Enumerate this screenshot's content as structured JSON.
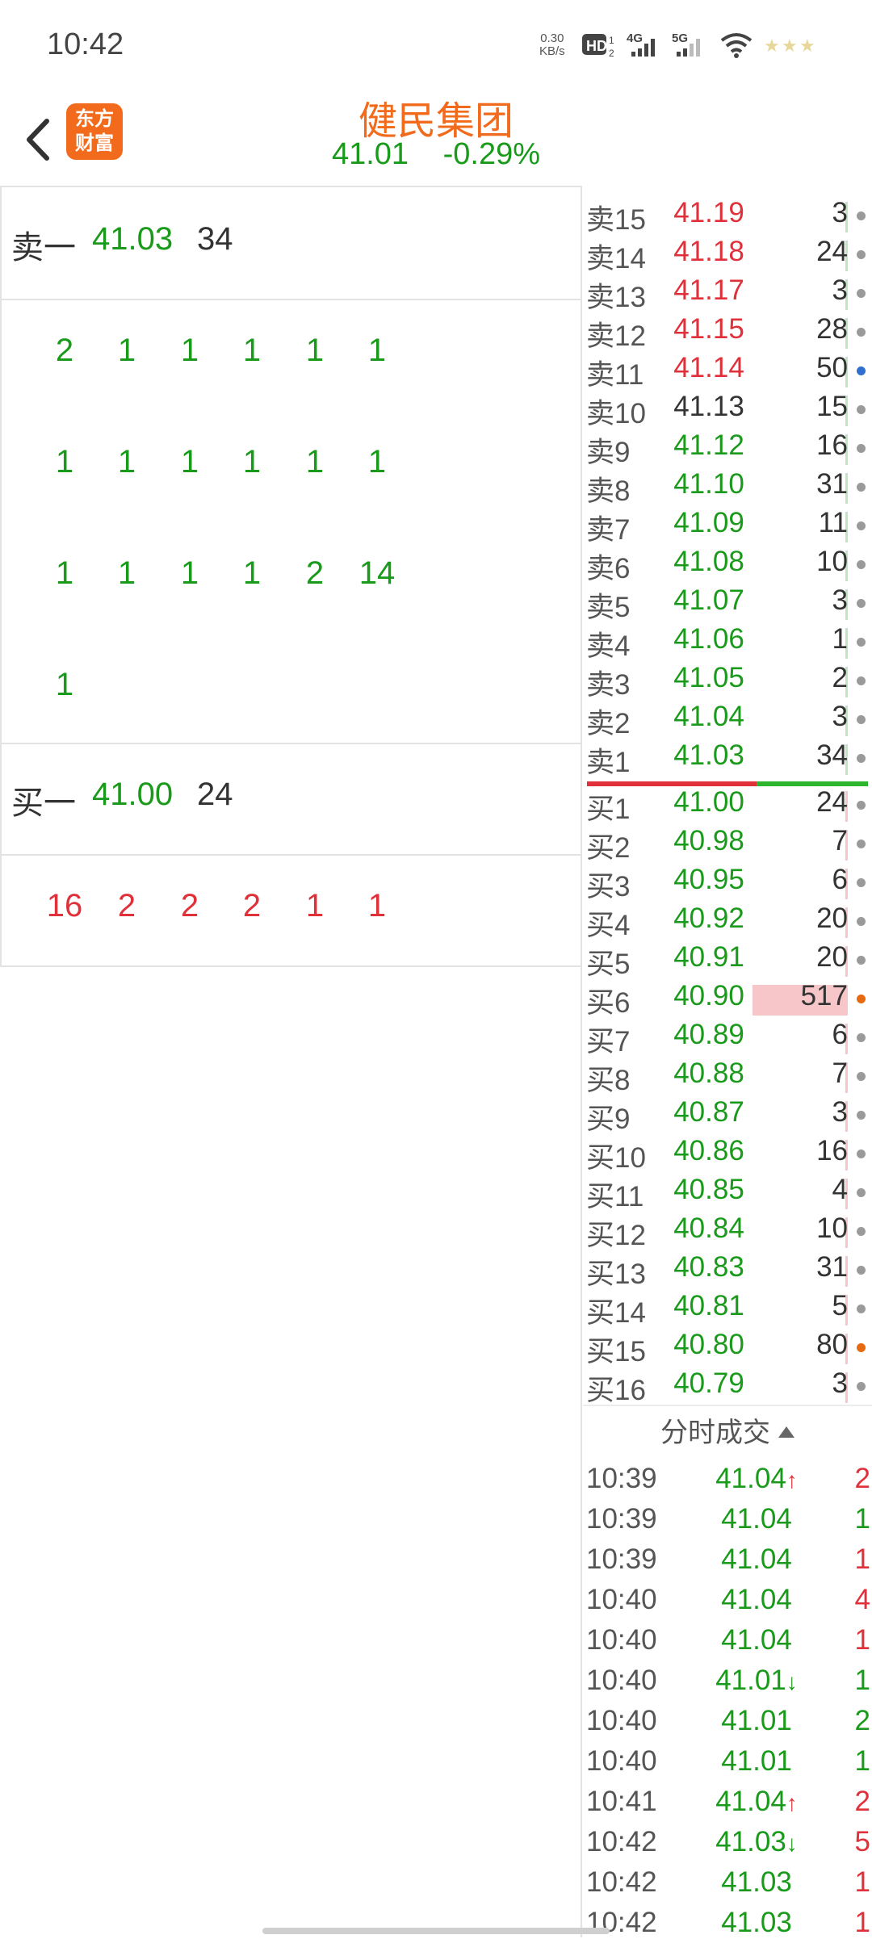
{
  "status_bar": {
    "time": "10:42",
    "speed_value": "0.30",
    "speed_unit": "KB/s",
    "icons": [
      "hd-icon",
      "signal-4g-icon",
      "signal-5g-icon",
      "wifi-icon",
      "battery-icon"
    ]
  },
  "header": {
    "title": "健民集团",
    "price": "41.01",
    "change": "-0.29%",
    "logo_line1": "东方",
    "logo_line2": "财富",
    "brand_color": "#f26a1b"
  },
  "left": {
    "sell": {
      "label": "卖一",
      "price": "41.03",
      "volume": "34"
    },
    "sell_queue": [
      [
        "2",
        "1",
        "1",
        "1",
        "1",
        "1"
      ],
      [
        "1",
        "1",
        "1",
        "1",
        "1",
        "1"
      ],
      [
        "1",
        "1",
        "1",
        "1",
        "2",
        "14"
      ],
      [
        "1"
      ]
    ],
    "buy": {
      "label": "买一",
      "price": "41.00",
      "volume": "24"
    },
    "buy_queue": [
      [
        "16",
        "2",
        "2",
        "2",
        "1",
        "1"
      ]
    ]
  },
  "order_book": {
    "asks": [
      {
        "label": "卖15",
        "price": "41.19",
        "vol": "3",
        "color": "red",
        "dot": "gray",
        "bar": 0
      },
      {
        "label": "卖14",
        "price": "41.18",
        "vol": "24",
        "color": "red",
        "dot": "gray",
        "bar": 0
      },
      {
        "label": "卖13",
        "price": "41.17",
        "vol": "3",
        "color": "red",
        "dot": "gray",
        "bar": 0
      },
      {
        "label": "卖12",
        "price": "41.15",
        "vol": "28",
        "color": "red",
        "dot": "gray",
        "bar": 0
      },
      {
        "label": "卖11",
        "price": "41.14",
        "vol": "50",
        "color": "red",
        "dot": "blue",
        "bar": 0
      },
      {
        "label": "卖10",
        "price": "41.13",
        "vol": "15",
        "color": "dark",
        "dot": "gray",
        "bar": 0
      },
      {
        "label": "卖9",
        "price": "41.12",
        "vol": "16",
        "color": "green",
        "dot": "gray",
        "bar": 0
      },
      {
        "label": "卖8",
        "price": "41.10",
        "vol": "31",
        "color": "green",
        "dot": "gray",
        "bar": 0
      },
      {
        "label": "卖7",
        "price": "41.09",
        "vol": "11",
        "color": "green",
        "dot": "gray",
        "bar": 0
      },
      {
        "label": "卖6",
        "price": "41.08",
        "vol": "10",
        "color": "green",
        "dot": "gray",
        "bar": 0
      },
      {
        "label": "卖5",
        "price": "41.07",
        "vol": "3",
        "color": "green",
        "dot": "gray",
        "bar": 0
      },
      {
        "label": "卖4",
        "price": "41.06",
        "vol": "1",
        "color": "green",
        "dot": "gray",
        "bar": 0
      },
      {
        "label": "卖3",
        "price": "41.05",
        "vol": "2",
        "color": "green",
        "dot": "gray",
        "bar": 0
      },
      {
        "label": "卖2",
        "price": "41.04",
        "vol": "3",
        "color": "green",
        "dot": "gray",
        "bar": 0
      },
      {
        "label": "卖1",
        "price": "41.03",
        "vol": "34",
        "color": "green",
        "dot": "gray",
        "bar": 0
      }
    ],
    "bids": [
      {
        "label": "买1",
        "price": "41.00",
        "vol": "24",
        "color": "green",
        "dot": "gray",
        "bar": 0
      },
      {
        "label": "买2",
        "price": "40.98",
        "vol": "7",
        "color": "green",
        "dot": "gray",
        "bar": 0
      },
      {
        "label": "买3",
        "price": "40.95",
        "vol": "6",
        "color": "green",
        "dot": "gray",
        "bar": 0
      },
      {
        "label": "买4",
        "price": "40.92",
        "vol": "20",
        "color": "green",
        "dot": "gray",
        "bar": 0
      },
      {
        "label": "买5",
        "price": "40.91",
        "vol": "20",
        "color": "green",
        "dot": "gray",
        "bar": 0
      },
      {
        "label": "买6",
        "price": "40.90",
        "vol": "517",
        "color": "green",
        "dot": "orange",
        "bar": 1
      },
      {
        "label": "买7",
        "price": "40.89",
        "vol": "6",
        "color": "green",
        "dot": "gray",
        "bar": 0
      },
      {
        "label": "买8",
        "price": "40.88",
        "vol": "7",
        "color": "green",
        "dot": "gray",
        "bar": 0
      },
      {
        "label": "买9",
        "price": "40.87",
        "vol": "3",
        "color": "green",
        "dot": "gray",
        "bar": 0
      },
      {
        "label": "买10",
        "price": "40.86",
        "vol": "16",
        "color": "green",
        "dot": "gray",
        "bar": 0
      },
      {
        "label": "买11",
        "price": "40.85",
        "vol": "4",
        "color": "green",
        "dot": "gray",
        "bar": 0
      },
      {
        "label": "买12",
        "price": "40.84",
        "vol": "10",
        "color": "green",
        "dot": "gray",
        "bar": 0
      },
      {
        "label": "买13",
        "price": "40.83",
        "vol": "31",
        "color": "green",
        "dot": "gray",
        "bar": 0
      },
      {
        "label": "买14",
        "price": "40.81",
        "vol": "5",
        "color": "green",
        "dot": "gray",
        "bar": 0
      },
      {
        "label": "买15",
        "price": "40.80",
        "vol": "80",
        "color": "green",
        "dot": "orange",
        "bar": 0
      },
      {
        "label": "买16",
        "price": "40.79",
        "vol": "3",
        "color": "green",
        "dot": "gray",
        "bar": 0
      }
    ]
  },
  "trades": {
    "title": "分时成交",
    "rows": [
      {
        "time": "10:39",
        "price": "41.04",
        "arrow": "↑",
        "vol": "2",
        "vcolor": "red"
      },
      {
        "time": "10:39",
        "price": "41.04",
        "arrow": "",
        "vol": "1",
        "vcolor": "green"
      },
      {
        "time": "10:39",
        "price": "41.04",
        "arrow": "",
        "vol": "1",
        "vcolor": "red"
      },
      {
        "time": "10:40",
        "price": "41.04",
        "arrow": "",
        "vol": "4",
        "vcolor": "red"
      },
      {
        "time": "10:40",
        "price": "41.04",
        "arrow": "",
        "vol": "1",
        "vcolor": "red"
      },
      {
        "time": "10:40",
        "price": "41.01",
        "arrow": "↓",
        "vol": "1",
        "vcolor": "green"
      },
      {
        "time": "10:40",
        "price": "41.01",
        "arrow": "",
        "vol": "2",
        "vcolor": "green"
      },
      {
        "time": "10:40",
        "price": "41.01",
        "arrow": "",
        "vol": "1",
        "vcolor": "green"
      },
      {
        "time": "10:41",
        "price": "41.04",
        "arrow": "↑",
        "vol": "2",
        "vcolor": "red"
      },
      {
        "time": "10:42",
        "price": "41.03",
        "arrow": "↓",
        "vol": "5",
        "vcolor": "red"
      },
      {
        "time": "10:42",
        "price": "41.03",
        "arrow": "",
        "vol": "1",
        "vcolor": "red"
      },
      {
        "time": "10:42",
        "price": "41.03",
        "arrow": "",
        "vol": "1",
        "vcolor": "red"
      }
    ]
  }
}
